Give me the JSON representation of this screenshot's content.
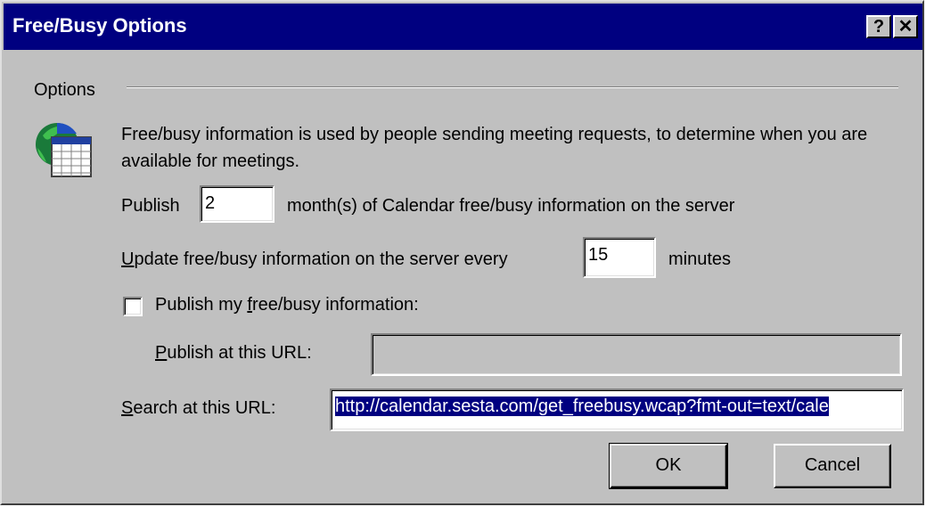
{
  "window": {
    "title": "Free/Busy Options",
    "help_glyph": "?",
    "close_glyph": "✕"
  },
  "options": {
    "group_label": "Options",
    "description": "Free/busy information is used by people sending meeting requests, to determine when you are available for meetings.",
    "publish_prefix": "Publish",
    "publish_months_value": "2",
    "publish_suffix": "month(s) of Calendar free/busy information on the server",
    "update_label_u": "U",
    "update_label_rest": "pdate free/busy information on the server every",
    "update_minutes_value": "15",
    "update_suffix": "minutes",
    "publish_checkbox_pre": "Publish my ",
    "publish_checkbox_u": "f",
    "publish_checkbox_post": "ree/busy information:",
    "publish_checkbox_checked": false,
    "publish_url_u": "P",
    "publish_url_rest": "ublish at this URL:",
    "publish_url_value": "",
    "search_url_u": "S",
    "search_url_rest": "earch at this URL:",
    "search_url_value": "http://calendar.sesta.com/get_freebusy.wcap?fmt-out=text/cale"
  },
  "buttons": {
    "ok": "OK",
    "cancel": "Cancel"
  },
  "icons": {
    "calendar": "globe-calendar-icon"
  }
}
